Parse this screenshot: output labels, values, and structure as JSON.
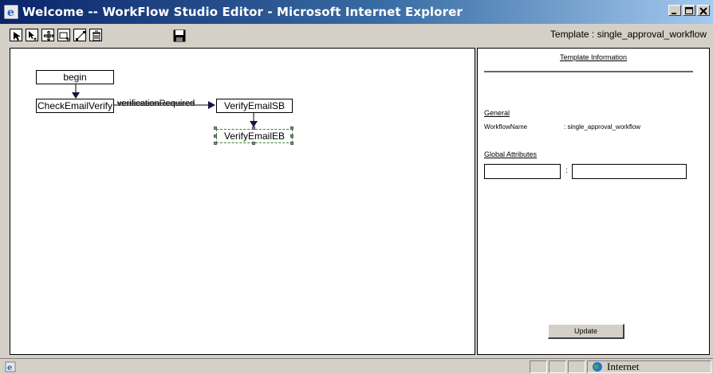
{
  "window": {
    "title": "Welcome -- WorkFlow Studio Editor - Microsoft Internet Explorer"
  },
  "toolbar": {
    "tools": [
      "select-tool-icon",
      "pointer-add-tool-icon",
      "move-tool-icon",
      "add-node-tool-icon",
      "connect-tool-icon",
      "delete-tool-icon",
      "save-icon"
    ],
    "template_label": "Template : single_approval_workflow"
  },
  "canvas": {
    "nodes": [
      {
        "id": "begin",
        "label": "begin"
      },
      {
        "id": "check",
        "label": "CheckEmailVerify"
      },
      {
        "id": "vsb",
        "label": "VerifyEmailSB"
      },
      {
        "id": "veb",
        "label": "VerifyEmailEB"
      }
    ],
    "edge_label": "verificationRequired"
  },
  "panel": {
    "title": "Template Information",
    "general_heading": "General",
    "workflow_name_key": "WorkflowName",
    "workflow_name_value": ": single_approval_workflow",
    "global_attributes_heading": "Global Attributes",
    "attr_key": "",
    "attr_value": "",
    "separator": ":",
    "update_label": "Update"
  },
  "statusbar": {
    "zone_label": "Internet"
  },
  "colors": {
    "title_start": "#0a246a",
    "title_end": "#a6caf0",
    "selection_border": "#2d8a2d"
  }
}
